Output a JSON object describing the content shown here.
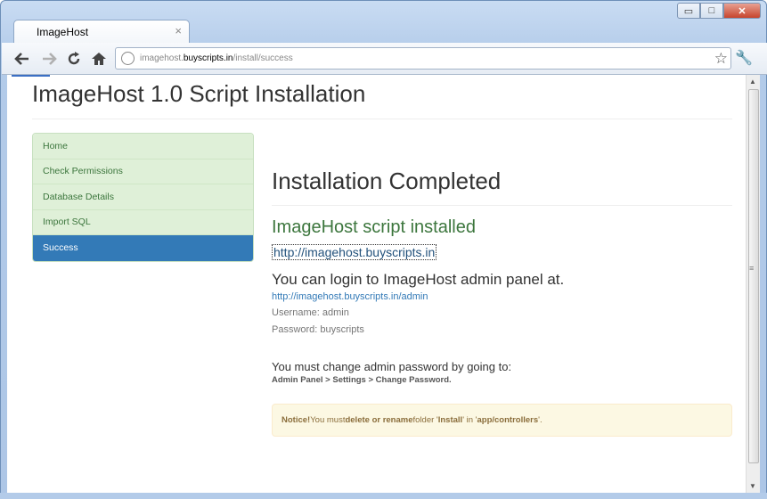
{
  "browser": {
    "tab_title": "ImageHost",
    "tab_close": "×",
    "url_prefix": "imagehost.",
    "url_domain": "buyscripts.in",
    "url_path": "/install/success",
    "window_controls": {
      "minimize": "▭",
      "maximize": "□",
      "close": "✕"
    }
  },
  "page": {
    "title": "ImageHost 1.0 Script Installation"
  },
  "sidebar": {
    "items": [
      {
        "label": "Home",
        "active": false
      },
      {
        "label": "Check Permissions",
        "active": false
      },
      {
        "label": "Database Details",
        "active": false
      },
      {
        "label": "Import SQL",
        "active": false
      },
      {
        "label": "Success",
        "active": true
      }
    ]
  },
  "main": {
    "heading": "Installation Completed",
    "installed_heading": "ImageHost script installed",
    "site_link": "http://imagehost.buyscripts.in",
    "login_heading": "You can login to ImageHost admin panel at.",
    "admin_link": "http://imagehost.buyscripts.in/admin",
    "username": "Username: admin",
    "password": "Password: buyscripts",
    "change_title": "You must change admin password by going to:",
    "change_path": "Admin Panel > Settings > Change Password.",
    "notice": {
      "label": "Notice!",
      "text_1": " You must ",
      "emph_1": "delete or rename",
      "text_2": " folder '",
      "emph_2": "Install",
      "text_3": "' in '",
      "emph_3": "app/controllers",
      "text_4": "'."
    }
  },
  "colors": {
    "active_nav": "#337ab7",
    "nav_bg": "#dff0d8",
    "success_text": "#3c763d",
    "alert_bg": "#fcf8e3"
  }
}
